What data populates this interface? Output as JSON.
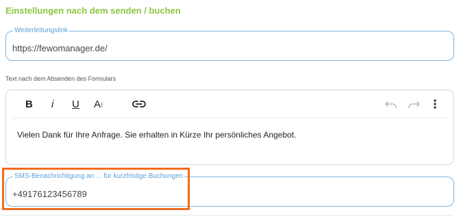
{
  "section": {
    "title": "Einstellungen nach dem senden / buchen"
  },
  "redirect": {
    "legend": "Weiterleitungslink",
    "value": "https://fewomanager.de/"
  },
  "message": {
    "label": "Text nach dem Absenden des Formulars",
    "toolbar": {
      "bold": "B",
      "italic": "i",
      "underline": "U",
      "font_size": "A",
      "link_icon": "link-icon",
      "undo_icon": "undo-icon",
      "redo_icon": "redo-icon",
      "more_icon": "more-vertical-icon"
    },
    "text": "Vielen Dank für Ihre Anfrage. Sie erhalten in Kürze Ihr persönliches Angebot."
  },
  "sms": {
    "legend": "SMS-Benachrichtigung an ... für kurzfristige Buchungen",
    "value": "+49176123456789"
  },
  "colors": {
    "accent_green": "#8cc63f",
    "field_blue": "#7fb3dd",
    "highlight_orange": "#f26b1d"
  }
}
